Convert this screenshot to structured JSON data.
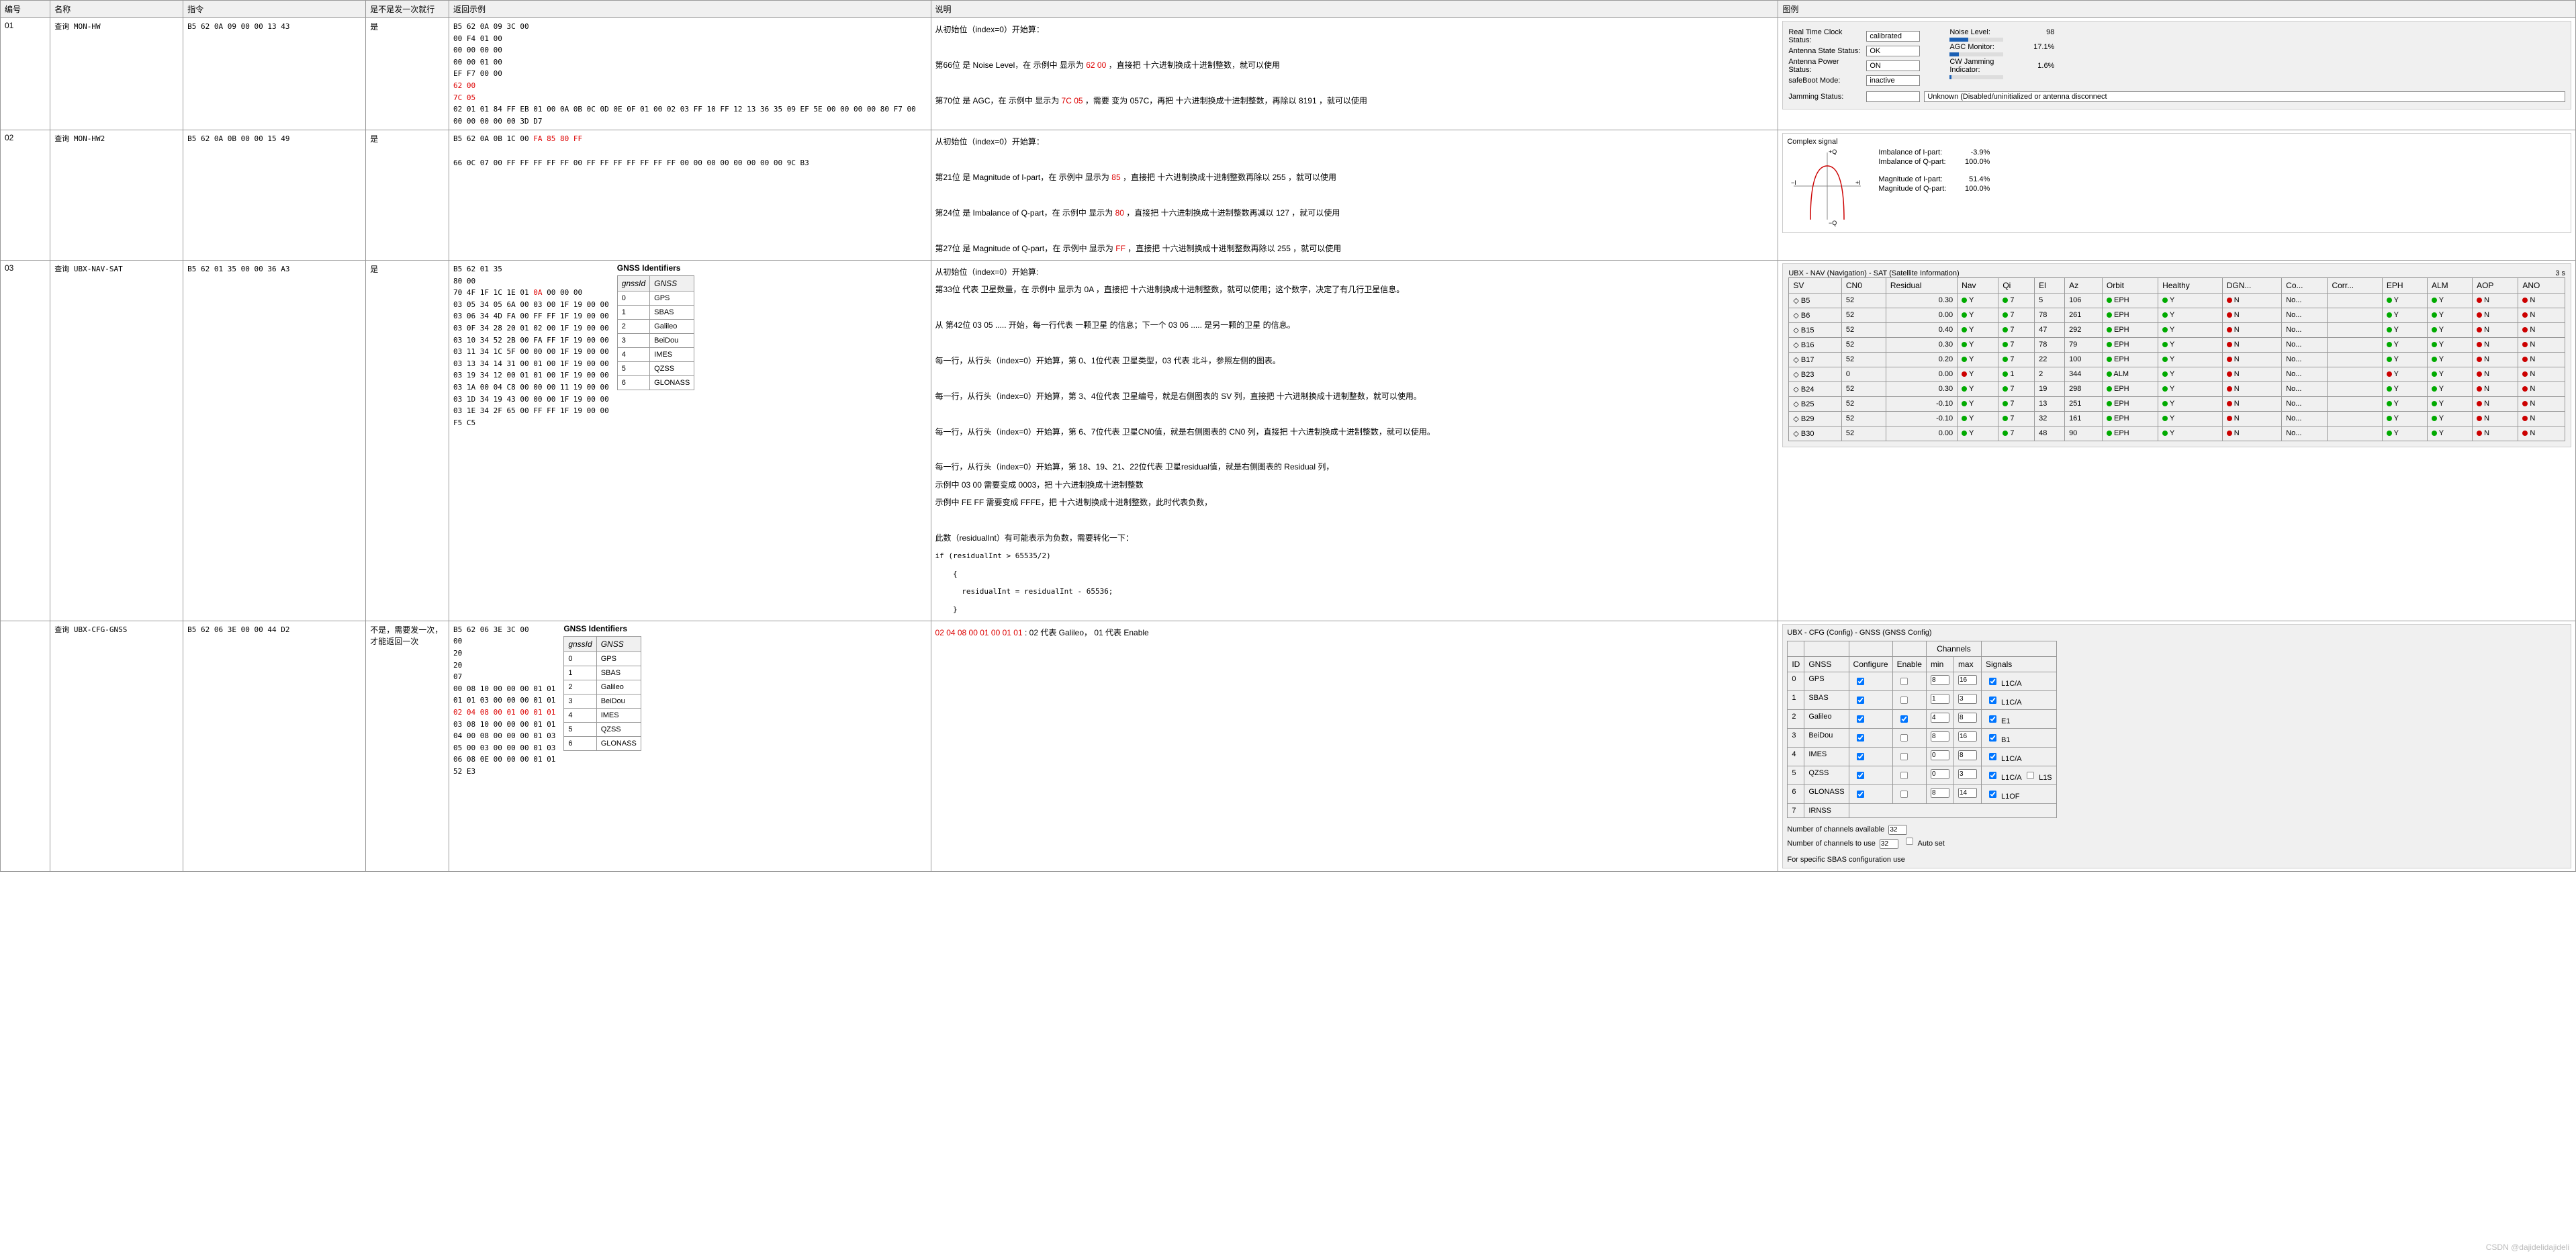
{
  "columns": {
    "c1": "编号",
    "c2": "名称",
    "c3": "指令",
    "c4": "是不是发一次就行",
    "c5": "返回示例",
    "c6": "说明",
    "c7": "图例"
  },
  "watermark": "CSDN @dajidelidajideli",
  "gnss_identifiers": {
    "title": "GNSS Identifiers",
    "h1": "gnssId",
    "h2": "GNSS",
    "rows": [
      [
        "0",
        "GPS"
      ],
      [
        "1",
        "SBAS"
      ],
      [
        "2",
        "Galileo"
      ],
      [
        "3",
        "BeiDou"
      ],
      [
        "4",
        "IMES"
      ],
      [
        "5",
        "QZSS"
      ],
      [
        "6",
        "GLONASS"
      ]
    ]
  },
  "rows": [
    {
      "id": "01",
      "name": "查询 MON-HW",
      "cmd": "B5 62 0A 09 00 00 13 43",
      "once": "是",
      "hex_plain_1": "B5 62 0A 09 3C 00\n00 F4 01 00\n00 00 00 00\n00 00 01 00\nEF F7 00 00",
      "hex_red_1": "62 00",
      "hex_red_2": "7C 05",
      "hex_plain_2": "02 01 01 84 FF EB 01 00 0A 0B 0C 0D 0E 0F 01 00 02 03 FF 10 FF 12 13 36 35 09 EF 5E 00 00 00 00 80 F7 00 00 00 00 00 00 3D D7",
      "desc_intro": "从初始位（index=0）开始算：",
      "desc_a1": "第66位 是 Noise Level，在 示例中 显示为  ",
      "desc_a2": " ，直接把 十六进制换成十进制整数，就可以使用",
      "desc_b1": "第70位 是 AGC，在 示例中 显示为  ",
      "desc_b2": " ，需要 变为 057C，再把 十六进制换成十进制整数，再除以 8191 ，就可以使用",
      "legend": {
        "rtc_label": "Real Time Clock Status:",
        "rtc_val": "calibrated",
        "ant_state_label": "Antenna State Status:",
        "ant_state_val": "OK",
        "ant_power_label": "Antenna Power Status:",
        "ant_power_val": "ON",
        "safeboot_label": "safeBoot Mode:",
        "safeboot_val": "inactive",
        "jam_status_label": "Jamming Status:",
        "jam_status_val": "Unknown (Disabled/uninitialized or antenna disconnect",
        "noise_label": "Noise Level:",
        "noise_val": "98",
        "agc_label": "AGC Monitor:",
        "agc_val": "17.1%",
        "cw_label": "CW Jamming Indicator:",
        "cw_val": "1.6%"
      }
    },
    {
      "id": "02",
      "name": "查询 MON-HW2",
      "cmd": "B5 62 0A 0B 00 00 15 49",
      "once": "是",
      "hex_pre": "B5 62 0A 0B 1C 00 ",
      "hex_red": "FA 85 80 FF",
      "hex_rest": "66 0C 07 00 FF FF FF FF FF 00 FF FF FF FF FF FF FF 00 00 00 00 00 00 00 00 9C B3",
      "desc_intro": "从初始位（index=0）开始算：",
      "d1a": "第21位 是 Magnitude of I-part，在 示例中 显示为 ",
      "d1r": "85",
      "d1b": " ，直接把 十六进制换成十进制整数再除以 255 ，就可以使用",
      "d2a": "第24位 是 Imbalance of Q-part，在 示例中 显示为 ",
      "d2r": "80",
      "d2b": " ，直接把 十六进制换成十进制整数再减以 127 ，就可以使用",
      "d3a": "第27位 是 Magnitude of Q-part，在 示例中 显示为 ",
      "d3r": "FF",
      "d3b": " ，直接把 十六进制换成十进制整数再除以 255 ，就可以使用",
      "legend": {
        "title": "Complex signal",
        "imb_i_label": "Imbalance of I-part:",
        "imb_i_val": "-3.9%",
        "imb_q_label": "Imbalance of Q-part:",
        "imb_q_val": "100.0%",
        "mag_i_label": "Magnitude of I-part:",
        "mag_i_val": "51.4%",
        "mag_q_label": "Magnitude of Q-part:",
        "mag_q_val": "100.0%",
        "axis_q": "+Q",
        "axis_i": "+I",
        "axis_ni": "−I",
        "axis_nq": "−Q"
      }
    },
    {
      "id": "03",
      "name": "查询 UBX-NAV-SAT",
      "cmd": "B5 62 01 35 00 00 36 A3",
      "once": "是",
      "hex_pre": "B5 62 01 35\n80 00\n70 4F 1F 1C 1E 01 ",
      "hex_red": "0A",
      "hex_rest": " 00 00 00\n03 05 34 05 6A 00 03 00 1F 19 00 00\n03 06 34 4D FA 00 FF FF 1F 19 00 00\n03 0F 34 28 20 01 02 00 1F 19 00 00\n03 10 34 52 2B 00 FA FF 1F 19 00 00\n03 11 34 1C 5F 00 00 00 1F 19 00 00\n03 13 34 14 31 00 01 00 1F 19 00 00\n03 19 34 12 00 01 01 00 1F 19 00 00\n03 1A 00 04 C8 00 00 00 11 19 00 00\n03 1D 34 19 43 00 00 00 1F 19 00 00\n03 1E 34 2F 65 00 FF FF 1F 19 00 00\nF5 C5",
      "d_intro": "从初始位（index=0）开始算:",
      "d_l1": "第33位 代表 卫星数量，在 示例中 显示为 0A ，直接把 十六进制换成十进制整数，就可以使用；这个数字，决定了有几行卫星信息。",
      "d_l2": "从 第42位 03 05 ..... 开始，每一行代表 一颗卫星 的信息；下一个 03 06 ..... 是另一颗的卫星 的信息。",
      "d_l3": "每一行，从行头（index=0）开始算，第 0、1位代表 卫星类型，03 代表 北斗，参照左侧的图表。",
      "d_l4": "每一行，从行头（index=0）开始算，第 3、4位代表 卫星编号，就是右侧图表的 SV 列，直接把 十六进制换成十进制整数，就可以使用。",
      "d_l5": "每一行，从行头（index=0）开始算，第 6、7位代表 卫星CN0值，就是右侧图表的 CN0 列，直接把 十六进制换成十进制整数，就可以使用。",
      "d_l6": "每一行，从行头（index=0）开始算，第 18、19、21、22位代表 卫星residual值，就是右侧图表的 Residual 列，",
      "d_l7": "  示例中 03 00 需要变成 0003，把 十六进制换成十进制整数",
      "d_l8": "  示例中 FE FF 需要变成 FFFE，把 十六进制换成十进制整数，此时代表负数，",
      "d_l9": "此数（residualInt）有可能表示为负数，需要转化一下：",
      "d_code": "if (residualInt > 65535/2)\n    {\n      residualInt = residualInt - 65536;\n    }",
      "legend": {
        "title": "UBX - NAV (Navigation) - SAT (Satellite Information)",
        "age": "3 s",
        "headers": [
          "SV",
          "CN0",
          "Residual",
          "Nav",
          "Qi",
          "El",
          "Az",
          "Orbit",
          "Healthy",
          "DGN...",
          "Co...",
          "Corr...",
          "EPH",
          "ALM",
          "AOP",
          "ANO"
        ],
        "rows": [
          {
            "sv": "B5",
            "cno": "52",
            "res": "0.30",
            "qi": "7",
            "el": "5",
            "az": "106",
            "orbit": "EPH",
            "corr": "No..."
          },
          {
            "sv": "B6",
            "cno": "52",
            "res": "0.00",
            "qi": "7",
            "el": "78",
            "az": "261",
            "orbit": "EPH",
            "corr": "No..."
          },
          {
            "sv": "B15",
            "cno": "52",
            "res": "0.40",
            "qi": "7",
            "el": "47",
            "az": "292",
            "orbit": "EPH",
            "corr": "No..."
          },
          {
            "sv": "B16",
            "cno": "52",
            "res": "0.30",
            "qi": "7",
            "el": "78",
            "az": "79",
            "orbit": "EPH",
            "corr": "No..."
          },
          {
            "sv": "B17",
            "cno": "52",
            "res": "0.20",
            "qi": "7",
            "el": "22",
            "az": "100",
            "orbit": "EPH",
            "corr": "No..."
          },
          {
            "sv": "B23",
            "cno": "0",
            "res": "0.00",
            "qi": "1",
            "el": "2",
            "az": "344",
            "orbit": "ALM",
            "corr": "No...",
            "nav_red": true,
            "eph_red": true
          },
          {
            "sv": "B24",
            "cno": "52",
            "res": "0.30",
            "qi": "7",
            "el": "19",
            "az": "298",
            "orbit": "EPH",
            "corr": "No..."
          },
          {
            "sv": "B25",
            "cno": "52",
            "res": "-0.10",
            "qi": "7",
            "el": "13",
            "az": "251",
            "orbit": "EPH",
            "corr": "No..."
          },
          {
            "sv": "B29",
            "cno": "52",
            "res": "-0.10",
            "qi": "7",
            "el": "32",
            "az": "161",
            "orbit": "EPH",
            "corr": "No..."
          },
          {
            "sv": "B30",
            "cno": "52",
            "res": "0.00",
            "qi": "7",
            "el": "48",
            "az": "90",
            "orbit": "EPH",
            "corr": "No..."
          }
        ],
        "y": "Y",
        "n": "N"
      }
    },
    {
      "id": "",
      "name": "查询 UBX-CFG-GNSS",
      "cmd": "B5 62 06 3E 00 00 44 D2",
      "once": "不是，需要发一次，才能返回一次",
      "hex_pre": "B5 62 06 3E 3C 00\n00\n20\n20\n07\n00 08 10 00 00 00 01 01\n01 01 03 00 00 00 01 01\n",
      "hex_red": "02 04 08 00 01 00 01 01",
      "hex_rest": "\n03 08 10 00 00 00 01 01\n04 00 08 00 00 00 01 03\n05 00 03 00 00 00 01 03\n06 08 0E 00 00 00 01 01\n52 E3",
      "desc_red": "02 04 08 00 01 00 01 01",
      "desc_rest": "  :  02 代表 Galileo，  01 代表 Enable",
      "legend": {
        "title": "UBX - CFG (Config) - GNSS (GNSS Config)",
        "headers": [
          "ID",
          "GNSS",
          "Configure",
          "Enable",
          "min",
          "max",
          "Signals"
        ],
        "ch_head": "Channels",
        "rows": [
          {
            "id": "0",
            "gnss": "GPS",
            "cfg": true,
            "en": false,
            "min": "8",
            "max": "16",
            "sig": "L1C/A"
          },
          {
            "id": "1",
            "gnss": "SBAS",
            "cfg": true,
            "en": false,
            "min": "1",
            "max": "3",
            "sig": "L1C/A"
          },
          {
            "id": "2",
            "gnss": "Galileo",
            "cfg": true,
            "en": true,
            "min": "4",
            "max": "8",
            "sig": "E1"
          },
          {
            "id": "3",
            "gnss": "BeiDou",
            "cfg": true,
            "en": false,
            "min": "8",
            "max": "16",
            "sig": "B1"
          },
          {
            "id": "4",
            "gnss": "IMES",
            "cfg": true,
            "en": false,
            "min": "0",
            "max": "8",
            "sig": "L1C/A"
          },
          {
            "id": "5",
            "gnss": "QZSS",
            "cfg": true,
            "en": false,
            "min": "0",
            "max": "3",
            "sig": "L1C/A",
            "sig2": "L1S"
          },
          {
            "id": "6",
            "gnss": "GLONASS",
            "cfg": true,
            "en": false,
            "min": "8",
            "max": "14",
            "sig": "L1OF"
          },
          {
            "id": "7",
            "gnss": "IRNSS"
          }
        ],
        "ch_avail_label": "Number of channels available",
        "ch_avail": "32",
        "ch_use_label": "Number of channels to use",
        "ch_use": "32",
        "auto_set": "Auto set",
        "footer": "For specific SBAS configuration use"
      }
    }
  ]
}
